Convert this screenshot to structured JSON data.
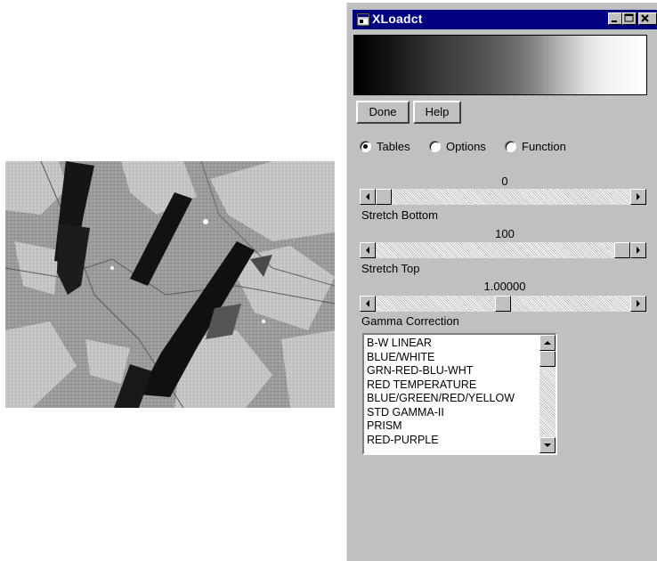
{
  "window": {
    "title": "XLoadct",
    "icon": "app-window-icon",
    "controls": [
      "minimize-icon",
      "maximize-icon",
      "close-icon"
    ]
  },
  "image": {
    "description_icon": "micrograph-image"
  },
  "colorbar": {
    "icon": "grayscale-color-table",
    "from_color": "#000000",
    "to_color": "#ffffff"
  },
  "buttons": {
    "done_label": "Done",
    "help_label": "Help"
  },
  "modes": [
    {
      "label": "Tables",
      "selected": true
    },
    {
      "label": "Options",
      "selected": false
    },
    {
      "label": "Function",
      "selected": false
    }
  ],
  "sliders": {
    "stretch_bottom": {
      "value_text": "0",
      "caption": "Stretch Bottom",
      "position_fraction": 0.0
    },
    "stretch_top": {
      "value_text": "100",
      "caption": "Stretch Top",
      "position_fraction": 1.0
    },
    "gamma": {
      "value_text": "1.00000",
      "caption": "Gamma Correction",
      "position_fraction": 0.5
    }
  },
  "color_tables": {
    "items": [
      "B-W LINEAR",
      "BLUE/WHITE",
      "GRN-RED-BLU-WHT",
      "RED TEMPERATURE",
      "BLUE/GREEN/RED/YELLOW",
      "STD GAMMA-II",
      "PRISM",
      "RED-PURPLE"
    ]
  },
  "colors": {
    "titlebar": "#000080",
    "face": "#c0c0c0"
  }
}
